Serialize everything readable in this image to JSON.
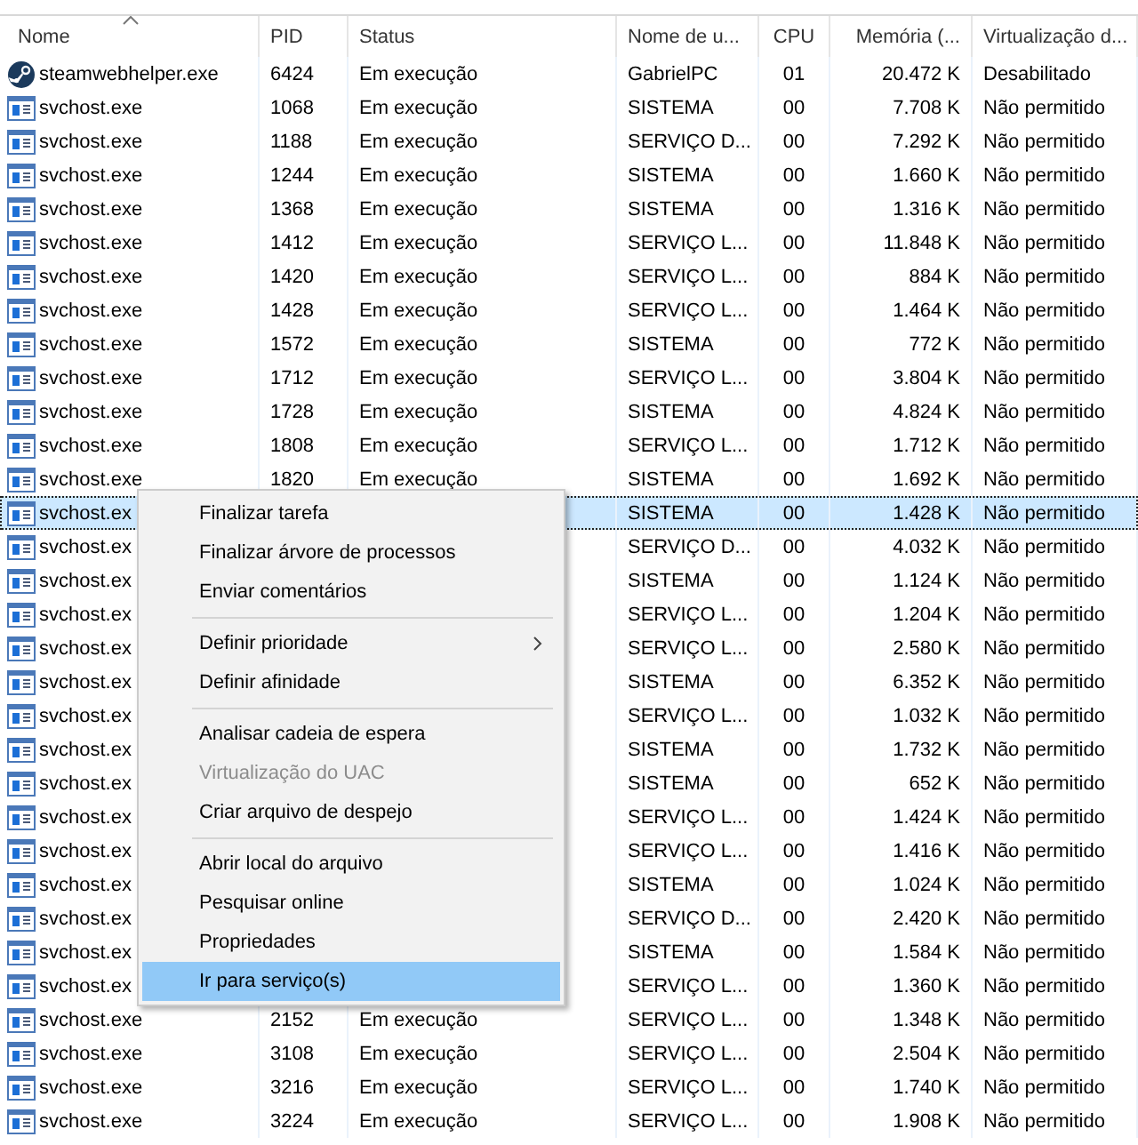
{
  "table": {
    "columns": [
      {
        "label": "Nome",
        "sorted": true
      },
      {
        "label": "PID",
        "sorted": false
      },
      {
        "label": "Status",
        "sorted": false
      },
      {
        "label": "Nome de u...",
        "sorted": false
      },
      {
        "label": "CPU",
        "sorted": false
      },
      {
        "label": "Memória (...",
        "sorted": false
      },
      {
        "label": "Virtualização d...",
        "sorted": false
      }
    ],
    "rows": [
      {
        "kind": "steam",
        "selected": false,
        "cells": [
          "steamwebhelper.exe",
          "6424",
          "Em execução",
          "GabrielPC",
          "01",
          "20.472 K",
          "Desabilitado"
        ]
      },
      {
        "kind": "service",
        "selected": false,
        "cells": [
          "svchost.exe",
          "1068",
          "Em execução",
          "SISTEMA",
          "00",
          "7.708 K",
          "Não permitido"
        ]
      },
      {
        "kind": "service",
        "selected": false,
        "cells": [
          "svchost.exe",
          "1188",
          "Em execução",
          "SERVIÇO D...",
          "00",
          "7.292 K",
          "Não permitido"
        ]
      },
      {
        "kind": "service",
        "selected": false,
        "cells": [
          "svchost.exe",
          "1244",
          "Em execução",
          "SISTEMA",
          "00",
          "1.660 K",
          "Não permitido"
        ]
      },
      {
        "kind": "service",
        "selected": false,
        "cells": [
          "svchost.exe",
          "1368",
          "Em execução",
          "SISTEMA",
          "00",
          "1.316 K",
          "Não permitido"
        ]
      },
      {
        "kind": "service",
        "selected": false,
        "cells": [
          "svchost.exe",
          "1412",
          "Em execução",
          "SERVIÇO L...",
          "00",
          "11.848 K",
          "Não permitido"
        ]
      },
      {
        "kind": "service",
        "selected": false,
        "cells": [
          "svchost.exe",
          "1420",
          "Em execução",
          "SERVIÇO L...",
          "00",
          "884 K",
          "Não permitido"
        ]
      },
      {
        "kind": "service",
        "selected": false,
        "cells": [
          "svchost.exe",
          "1428",
          "Em execução",
          "SERVIÇO L...",
          "00",
          "1.464 K",
          "Não permitido"
        ]
      },
      {
        "kind": "service",
        "selected": false,
        "cells": [
          "svchost.exe",
          "1572",
          "Em execução",
          "SISTEMA",
          "00",
          "772 K",
          "Não permitido"
        ]
      },
      {
        "kind": "service",
        "selected": false,
        "cells": [
          "svchost.exe",
          "1712",
          "Em execução",
          "SERVIÇO L...",
          "00",
          "3.804 K",
          "Não permitido"
        ]
      },
      {
        "kind": "service",
        "selected": false,
        "cells": [
          "svchost.exe",
          "1728",
          "Em execução",
          "SISTEMA",
          "00",
          "4.824 K",
          "Não permitido"
        ]
      },
      {
        "kind": "service",
        "selected": false,
        "cells": [
          "svchost.exe",
          "1808",
          "Em execução",
          "SERVIÇO L...",
          "00",
          "1.712 K",
          "Não permitido"
        ]
      },
      {
        "kind": "service",
        "selected": false,
        "cells": [
          "svchost.exe",
          "1820",
          "Em execução",
          "SISTEMA",
          "00",
          "1.692 K",
          "Não permitido"
        ]
      },
      {
        "kind": "service",
        "selected": true,
        "cells": [
          "svchost.ex",
          "",
          "",
          "SISTEMA",
          "00",
          "1.428 K",
          "Não permitido"
        ]
      },
      {
        "kind": "service",
        "selected": false,
        "cells": [
          "svchost.ex",
          "",
          "",
          "SERVIÇO D...",
          "00",
          "4.032 K",
          "Não permitido"
        ]
      },
      {
        "kind": "service",
        "selected": false,
        "cells": [
          "svchost.ex",
          "",
          "",
          "SISTEMA",
          "00",
          "1.124 K",
          "Não permitido"
        ]
      },
      {
        "kind": "service",
        "selected": false,
        "cells": [
          "svchost.ex",
          "",
          "",
          "SERVIÇO L...",
          "00",
          "1.204 K",
          "Não permitido"
        ]
      },
      {
        "kind": "service",
        "selected": false,
        "cells": [
          "svchost.ex",
          "",
          "",
          "SERVIÇO L...",
          "00",
          "2.580 K",
          "Não permitido"
        ]
      },
      {
        "kind": "service",
        "selected": false,
        "cells": [
          "svchost.ex",
          "",
          "",
          "SISTEMA",
          "00",
          "6.352 K",
          "Não permitido"
        ]
      },
      {
        "kind": "service",
        "selected": false,
        "cells": [
          "svchost.ex",
          "",
          "",
          "SERVIÇO L...",
          "00",
          "1.032 K",
          "Não permitido"
        ]
      },
      {
        "kind": "service",
        "selected": false,
        "cells": [
          "svchost.ex",
          "",
          "",
          "SISTEMA",
          "00",
          "1.732 K",
          "Não permitido"
        ]
      },
      {
        "kind": "service",
        "selected": false,
        "cells": [
          "svchost.ex",
          "",
          "",
          "SISTEMA",
          "00",
          "652 K",
          "Não permitido"
        ]
      },
      {
        "kind": "service",
        "selected": false,
        "cells": [
          "svchost.ex",
          "",
          "",
          "SERVIÇO L...",
          "00",
          "1.424 K",
          "Não permitido"
        ]
      },
      {
        "kind": "service",
        "selected": false,
        "cells": [
          "svchost.ex",
          "",
          "",
          "SERVIÇO L...",
          "00",
          "1.416 K",
          "Não permitido"
        ]
      },
      {
        "kind": "service",
        "selected": false,
        "cells": [
          "svchost.ex",
          "",
          "",
          "SISTEMA",
          "00",
          "1.024 K",
          "Não permitido"
        ]
      },
      {
        "kind": "service",
        "selected": false,
        "cells": [
          "svchost.ex",
          "",
          "",
          "SERVIÇO D...",
          "00",
          "2.420 K",
          "Não permitido"
        ]
      },
      {
        "kind": "service",
        "selected": false,
        "cells": [
          "svchost.ex",
          "",
          "",
          "SISTEMA",
          "00",
          "1.584 K",
          "Não permitido"
        ]
      },
      {
        "kind": "service",
        "selected": false,
        "cells": [
          "svchost.ex",
          "",
          "",
          "SERVIÇO L...",
          "00",
          "1.360 K",
          "Não permitido"
        ]
      },
      {
        "kind": "service",
        "selected": false,
        "cells": [
          "svchost.exe",
          "2152",
          "Em execução",
          "SERVIÇO L...",
          "00",
          "1.348 K",
          "Não permitido"
        ]
      },
      {
        "kind": "service",
        "selected": false,
        "cells": [
          "svchost.exe",
          "3108",
          "Em execução",
          "SERVIÇO L...",
          "00",
          "2.504 K",
          "Não permitido"
        ]
      },
      {
        "kind": "service",
        "selected": false,
        "cells": [
          "svchost.exe",
          "3216",
          "Em execução",
          "SERVIÇO L...",
          "00",
          "1.740 K",
          "Não permitido"
        ]
      },
      {
        "kind": "service",
        "selected": false,
        "cells": [
          "svchost.exe",
          "3224",
          "Em execução",
          "SERVIÇO L...",
          "00",
          "1.908 K",
          "Não permitido"
        ]
      }
    ]
  },
  "context_menu": {
    "items": [
      {
        "kind": "item",
        "label": "Finalizar tarefa",
        "disabled": false,
        "selected": false,
        "submenu": false
      },
      {
        "kind": "item",
        "label": "Finalizar árvore de processos",
        "disabled": false,
        "selected": false,
        "submenu": false
      },
      {
        "kind": "item",
        "label": "Enviar comentários",
        "disabled": false,
        "selected": false,
        "submenu": false
      },
      {
        "kind": "separator"
      },
      {
        "kind": "item",
        "label": "Definir prioridade",
        "disabled": false,
        "selected": false,
        "submenu": true
      },
      {
        "kind": "item",
        "label": "Definir afinidade",
        "disabled": false,
        "selected": false,
        "submenu": false
      },
      {
        "kind": "separator"
      },
      {
        "kind": "item",
        "label": "Analisar cadeia de espera",
        "disabled": false,
        "selected": false,
        "submenu": false
      },
      {
        "kind": "item",
        "label": "Virtualização do UAC",
        "disabled": true,
        "selected": false,
        "submenu": false
      },
      {
        "kind": "item",
        "label": "Criar arquivo de despejo",
        "disabled": false,
        "selected": false,
        "submenu": false
      },
      {
        "kind": "separator"
      },
      {
        "kind": "item",
        "label": "Abrir local do arquivo",
        "disabled": false,
        "selected": false,
        "submenu": false
      },
      {
        "kind": "item",
        "label": "Pesquisar online",
        "disabled": false,
        "selected": false,
        "submenu": false
      },
      {
        "kind": "item",
        "label": "Propriedades",
        "disabled": false,
        "selected": false,
        "submenu": false
      },
      {
        "kind": "item",
        "label": "Ir para serviço(s)",
        "disabled": false,
        "selected": true,
        "submenu": false
      }
    ]
  }
}
